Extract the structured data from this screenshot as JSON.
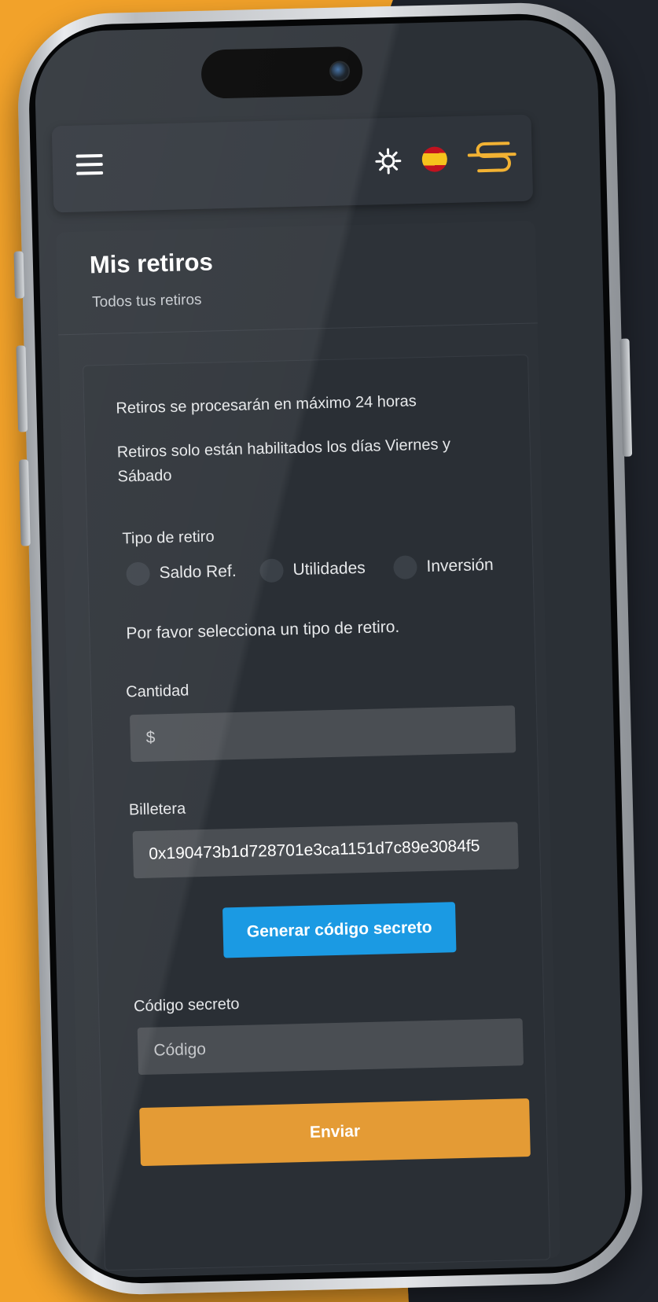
{
  "header": {
    "menu_icon": "hamburger-menu-icon",
    "theme_icon": "sun-icon",
    "language_icon": "spain-flag-icon",
    "logo_icon": "brand-logo-icon",
    "accent_color": "#f2b233"
  },
  "page": {
    "title": "Mis retiros",
    "subtitle": "Todos tus retiros"
  },
  "notes": {
    "processing": "Retiros se procesarán en máximo 24 horas",
    "days": "Retiros solo están habilitados los días Viernes y Sábado"
  },
  "withdraw_type": {
    "label": "Tipo de retiro",
    "options": [
      "Saldo Ref.",
      "Utilidades",
      "Inversión"
    ],
    "hint": "Por favor selecciona un tipo de retiro."
  },
  "amount": {
    "label": "Cantidad",
    "placeholder": "$"
  },
  "wallet": {
    "label": "Billetera",
    "value": "0x190473b1d728701e3ca1151d7c89e3084f5"
  },
  "generate_button": "Generar código secreto",
  "secret_code": {
    "label": "Código secreto",
    "placeholder": "Código"
  },
  "submit_button": "Enviar",
  "colors": {
    "background_accent": "#f2a22a",
    "primary_blue": "#1b9ae3",
    "submit_orange": "#e49b35"
  }
}
